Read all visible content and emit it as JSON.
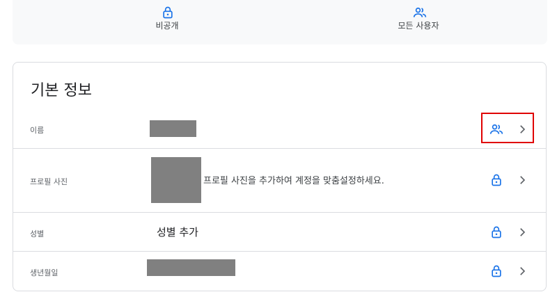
{
  "visibility": {
    "private_label": "비공개",
    "public_label": "모든 사용자"
  },
  "basic_info": {
    "title": "기본 정보",
    "rows": [
      {
        "label": "이름",
        "value": "",
        "visibility_icon": "people-icon"
      },
      {
        "label": "프로필 사진",
        "value": "프로필 사진을 추가하여 계정을 맞춤설정하세요.",
        "visibility_icon": "lock-icon"
      },
      {
        "label": "성별",
        "value": "성별 추가",
        "visibility_icon": "lock-icon"
      },
      {
        "label": "생년월일",
        "value": "",
        "visibility_icon": "lock-icon"
      }
    ]
  },
  "colors": {
    "accent": "#1a73e8",
    "highlight": "#e00000",
    "redacted": "#808080"
  }
}
